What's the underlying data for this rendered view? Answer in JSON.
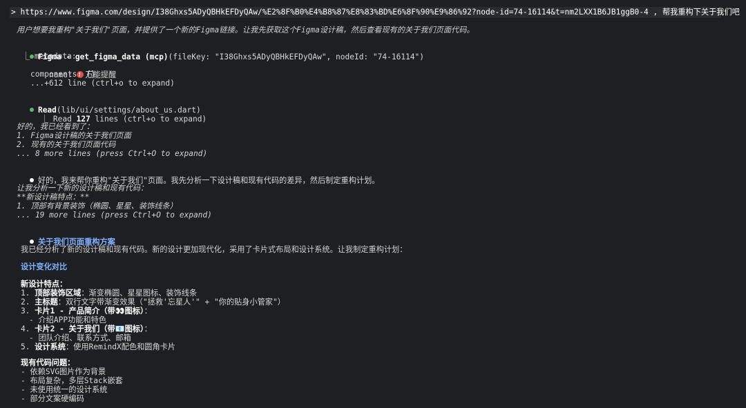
{
  "prompt": {
    "text": "> https://www.figma.com/design/I38Ghxs5ADyQBHkEFDyQAw/%E2%8F%B0%E4%B8%87%E8%83%BD%E6%8F%90%E9%86%92?node-id=74-16114&t=nm2LXX1B6JB1ggB0-4 , 帮我重构下关于我们吧"
  },
  "intro": "用户想要我重构\"关于我们\"页面，并提供了一个新的Figma链接。让我先获取这个Figma设计稿，然后查看现有的关于我们页面代码。",
  "tool1": {
    "name": "Figma - get_figma_data (mcp)",
    "args": "(fileKey: \"I38Ghxs5ADyQBHkEFDyQAw\", nodeId: \"74-16114\")",
    "l1": "⎿ metadata:",
    "l2_prefix": "name: ",
    "l2_name": "万能提醒",
    "l3": "components: {}",
    "l4": "...+612 line (ctrl+o to expand)"
  },
  "tool2": {
    "name": "Read",
    "args": "(lib/ui/settings/about_us.dart)",
    "l1_a": "⎿ Read ",
    "l1_b": "127",
    "l1_c": " lines (ctrl+o to expand)"
  },
  "think1": {
    "l1": "好的，我已经看到了：",
    "l2": "1. Figma设计稿的关于我们页面",
    "l3": "2. 现有的关于我们页面代码",
    "l4": "... 8 more lines (press Ctrl+O to expand)"
  },
  "msg1": "好的，我来帮你重构\"关于我们\"页面。我先分析一下设计稿和现有代码的差异，然后制定重构计划。",
  "think2": {
    "l1": "让我分析一下新的设计稿和现有代码：",
    "l2": "**新设计稿特点：**",
    "l3": "1. 顶部有背景装饰（椭圆、星星、装饰线条）",
    "l4": "... 19 more lines (press Ctrl+O to expand)"
  },
  "plan": {
    "title": "关于我们页面重构方案",
    "desc": "我已经分析了新的设计稿和现有代码。新的设计更加现代化，采用了卡片式布局和设计系统。让我制定重构计划：",
    "section": "设计变化对比",
    "new_title": "新设计特点：",
    "new_items": [
      {
        "n": "1. ",
        "k": "顶部装饰区域",
        "v": "：渐变椭圆、星星图标、装饰线条"
      },
      {
        "n": "2. ",
        "k": "主标题",
        "v": "：双行文字带渐变效果（\"拯救'忘星人'\" + \"你的贴身小管家\"）"
      },
      {
        "n": "3. ",
        "k": "卡片1 - 产品简介（带👀图标）",
        "v": "："
      },
      {
        "n": "  ",
        "k": "",
        "v": "- 介绍APP功能和特色"
      },
      {
        "n": "4. ",
        "k": "卡片2 - 关于我们（带📧图标）",
        "v": "："
      },
      {
        "n": "  ",
        "k": "",
        "v": "- 团队介绍、联系方式、邮箱"
      },
      {
        "n": "5. ",
        "k": "设计系统",
        "v": "：使用RemindX配色和圆角卡片"
      }
    ],
    "old_title": "现有代码问题：",
    "old_items": [
      "- 依赖SVG图片作为背景",
      "- 布局复杂，多层Stack嵌套",
      "- 未使用统一的设计系统",
      "- 部分文案硬编码"
    ]
  }
}
